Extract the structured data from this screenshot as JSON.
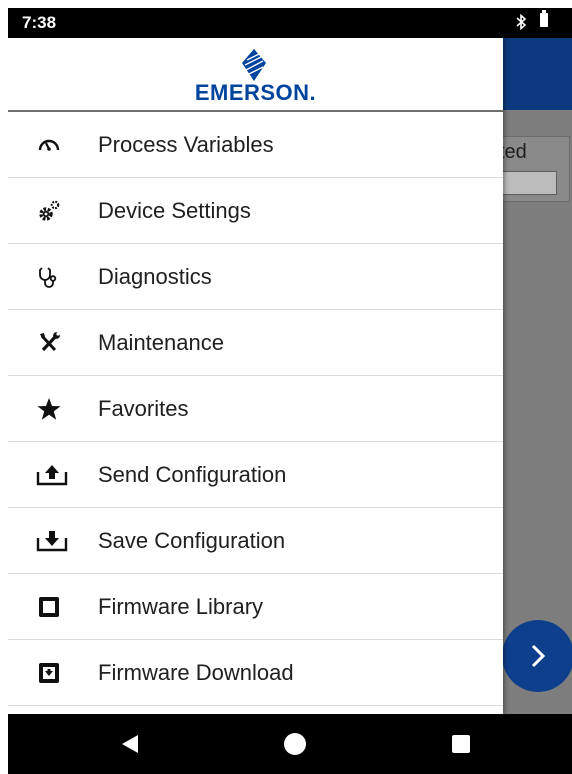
{
  "status_bar": {
    "time": "7:38",
    "icons": [
      "bluetooth-icon",
      "battery-icon"
    ]
  },
  "background_app": {
    "field_text_fragment": "ted",
    "next_button_icon": "chevron-right-icon",
    "header_color": "#0d3a7e"
  },
  "drawer": {
    "logo_text": "EMERSON.",
    "brand_color": "#00449e",
    "items": [
      {
        "label": "Process Variables",
        "icon": "gauge-icon"
      },
      {
        "label": "Device Settings",
        "icon": "gears-icon"
      },
      {
        "label": "Diagnostics",
        "icon": "stethoscope-icon"
      },
      {
        "label": "Maintenance",
        "icon": "tools-icon"
      },
      {
        "label": "Favorites",
        "icon": "star-icon"
      },
      {
        "label": "Send Configuration",
        "icon": "upload-tray-icon"
      },
      {
        "label": "Save Configuration",
        "icon": "download-tray-icon"
      },
      {
        "label": "Firmware Library",
        "icon": "chip-icon"
      },
      {
        "label": "Firmware Download",
        "icon": "chip-download-icon"
      }
    ]
  },
  "nav_bar": {
    "buttons": [
      "back-icon",
      "home-icon",
      "recents-icon"
    ]
  }
}
